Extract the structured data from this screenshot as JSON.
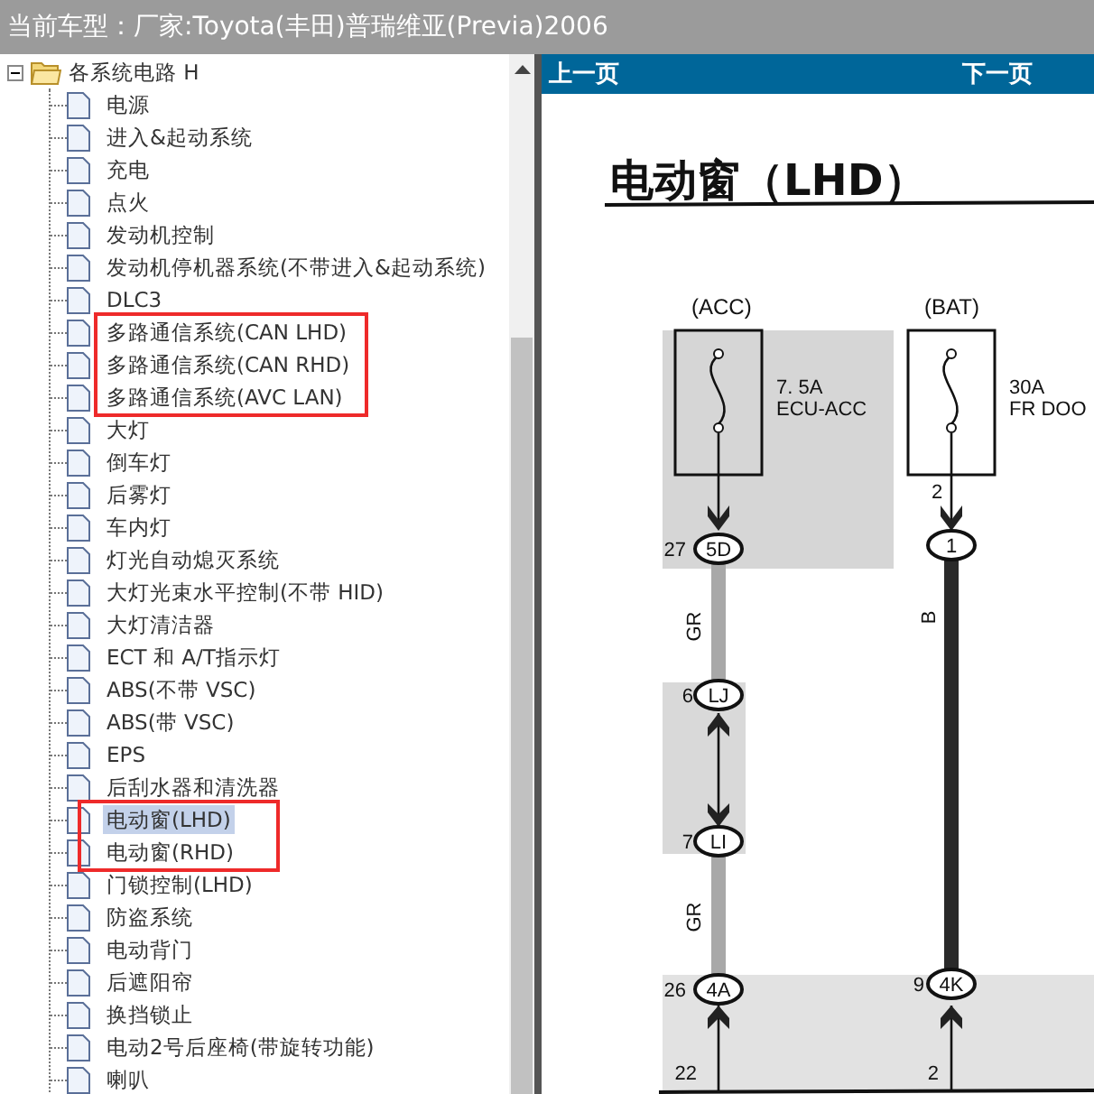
{
  "header": {
    "title": "当前车型：厂家:Toyota(丰田)普瑞维亚(Previa)2006"
  },
  "tree": {
    "root": {
      "label": "各系统电路 H",
      "expanded": true,
      "children": [
        {
          "label": "电源",
          "selected": false,
          "boxed": false
        },
        {
          "label": "进入&起动系统",
          "selected": false,
          "boxed": false
        },
        {
          "label": "充电",
          "selected": false,
          "boxed": false
        },
        {
          "label": "点火",
          "selected": false,
          "boxed": false
        },
        {
          "label": "发动机控制",
          "selected": false,
          "boxed": false
        },
        {
          "label": "发动机停机器系统(不带进入&起动系统)",
          "selected": false,
          "boxed": false
        },
        {
          "label": "DLC3",
          "selected": false,
          "boxed": false
        },
        {
          "label": "多路通信系统(CAN LHD)",
          "selected": false,
          "boxed": true
        },
        {
          "label": "多路通信系统(CAN RHD)",
          "selected": false,
          "boxed": true
        },
        {
          "label": "多路通信系统(AVC  LAN)",
          "selected": false,
          "boxed": true
        },
        {
          "label": "大灯",
          "selected": false,
          "boxed": false
        },
        {
          "label": "倒车灯",
          "selected": false,
          "boxed": false
        },
        {
          "label": "后雾灯",
          "selected": false,
          "boxed": false
        },
        {
          "label": "车内灯",
          "selected": false,
          "boxed": false
        },
        {
          "label": "灯光自动熄灭系统",
          "selected": false,
          "boxed": false
        },
        {
          "label": "大灯光束水平控制(不带 HID)",
          "selected": false,
          "boxed": false
        },
        {
          "label": "大灯清洁器",
          "selected": false,
          "boxed": false
        },
        {
          "label": "ECT 和 A/T指示灯",
          "selected": false,
          "boxed": false
        },
        {
          "label": "ABS(不带 VSC)",
          "selected": false,
          "boxed": false
        },
        {
          "label": "ABS(带 VSC)",
          "selected": false,
          "boxed": false
        },
        {
          "label": "EPS",
          "selected": false,
          "boxed": false
        },
        {
          "label": "后刮水器和清洗器",
          "selected": false,
          "boxed": false
        },
        {
          "label": "电动窗(LHD)",
          "selected": true,
          "boxed": true
        },
        {
          "label": "电动窗(RHD)",
          "selected": false,
          "boxed": true
        },
        {
          "label": "门锁控制(LHD)",
          "selected": false,
          "boxed": false
        },
        {
          "label": "防盗系统",
          "selected": false,
          "boxed": false
        },
        {
          "label": "电动背门",
          "selected": false,
          "boxed": false
        },
        {
          "label": "后遮阳帘",
          "selected": false,
          "boxed": false
        },
        {
          "label": "换挡锁止",
          "selected": false,
          "boxed": false
        },
        {
          "label": "电动2号后座椅(带旋转功能)",
          "selected": false,
          "boxed": false
        },
        {
          "label": "喇叭",
          "selected": false,
          "boxed": false
        }
      ]
    }
  },
  "nav": {
    "prev": "上一页",
    "next": "下一页"
  },
  "diagram": {
    "title": "电动窗（LHD）",
    "fuses": [
      {
        "supply": "(ACC)",
        "rating": "7. 5A",
        "name": "ECU-ACC"
      },
      {
        "supply": "(BAT)",
        "rating": "30A",
        "name": "FR DOO"
      }
    ],
    "fuse_pins": [
      "2"
    ],
    "connectors": [
      {
        "pin": "27",
        "code": "5D"
      },
      {
        "code": "1"
      },
      {
        "pin": "6",
        "code": "LJ"
      },
      {
        "pin": "7",
        "code": "LI"
      },
      {
        "pin": "26",
        "code": "4A"
      },
      {
        "pin": "9",
        "code": "4K"
      }
    ],
    "wire_colors": [
      "GR",
      "B",
      "GR"
    ],
    "bottom_pins": [
      "22",
      "2"
    ]
  }
}
